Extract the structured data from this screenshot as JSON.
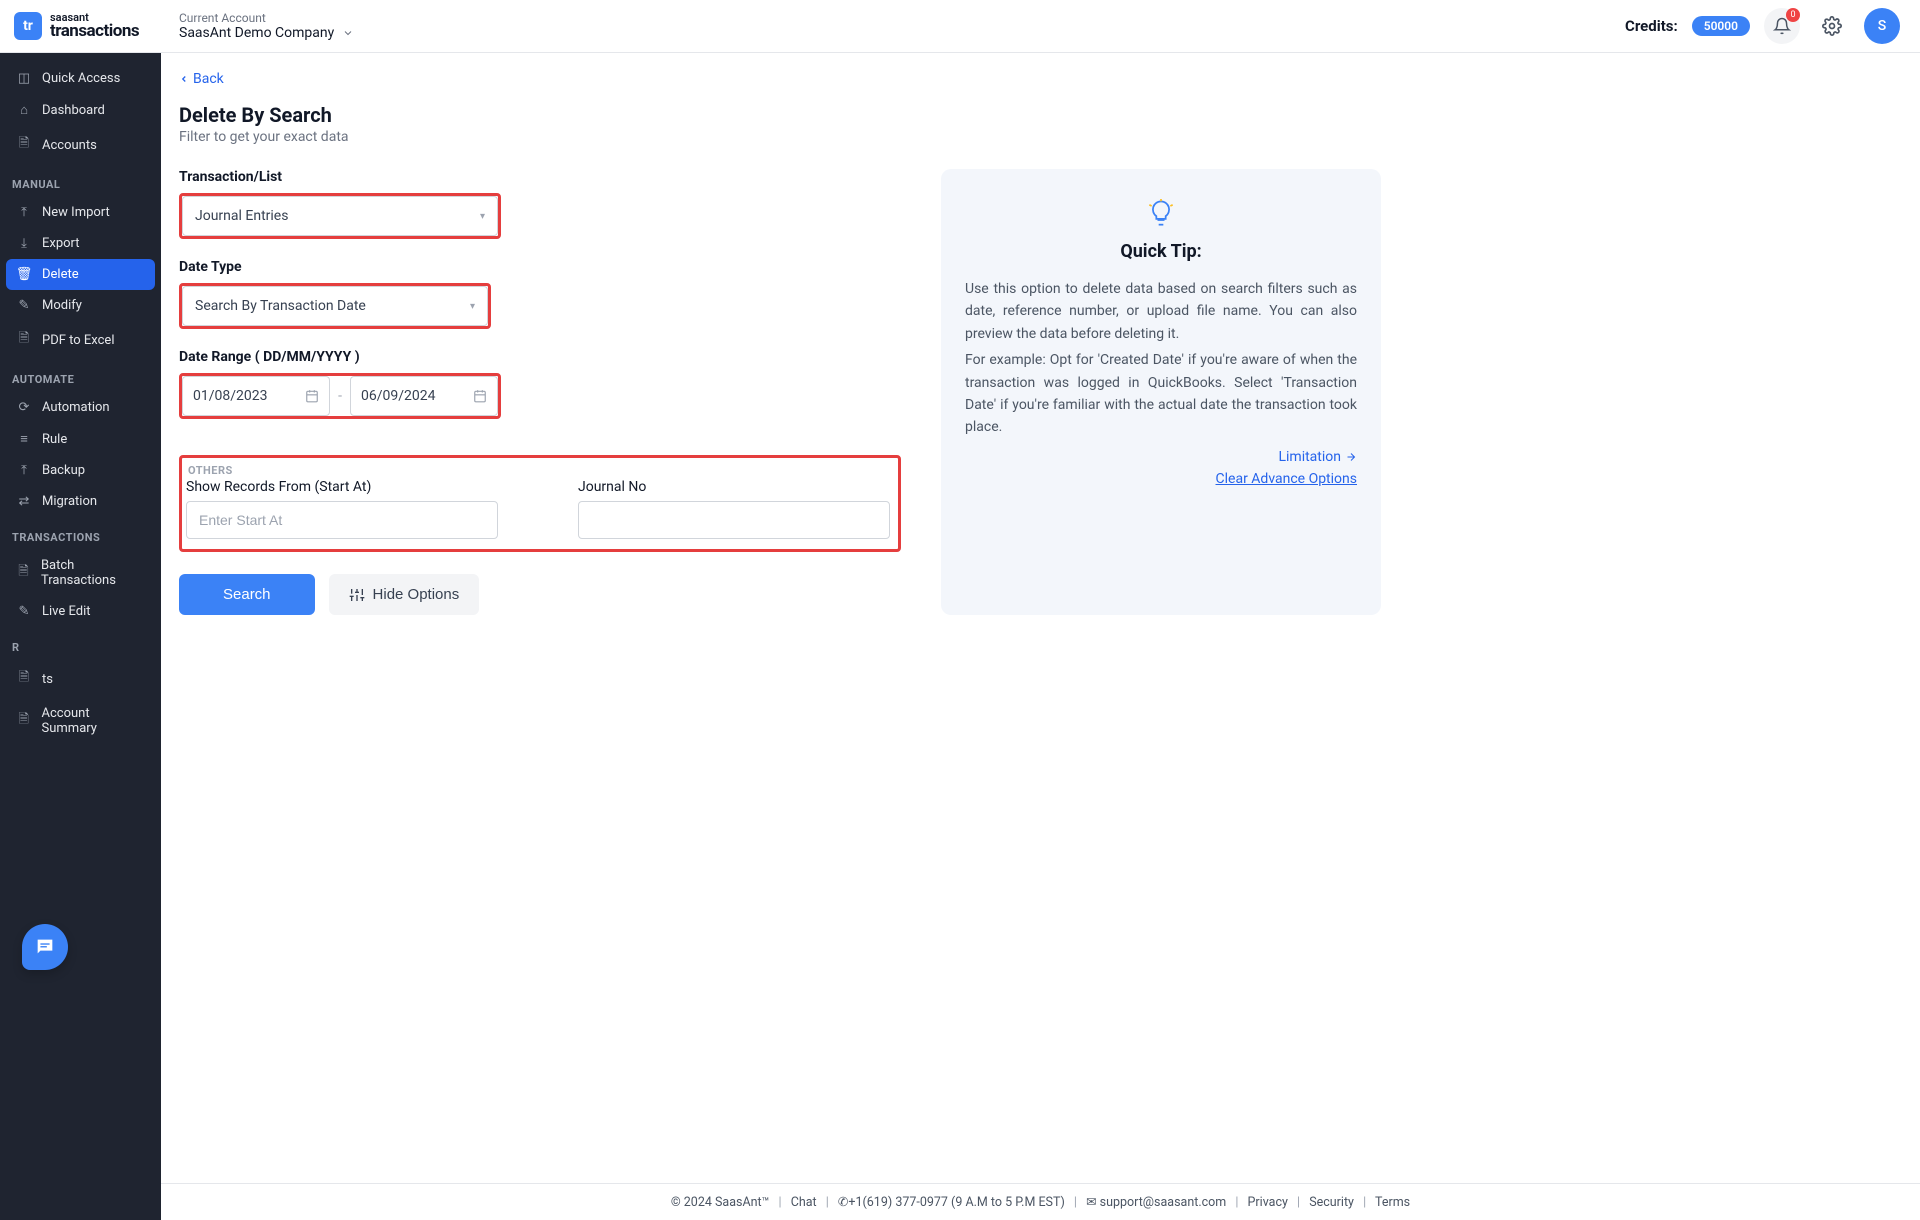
{
  "header": {
    "logo_small": "tr",
    "logo_top": "saasant",
    "logo_bottom": "transactions",
    "account_label": "Current Account",
    "account_name": "SaasAnt Demo Company",
    "credits_label": "Credits:",
    "credits_value": "50000",
    "notif_count": "0",
    "avatar_initial": "S"
  },
  "sidebar": {
    "items_top": [
      {
        "icon": "⊞",
        "label": "Quick Access"
      },
      {
        "icon": "⌂",
        "label": "Dashboard"
      },
      {
        "icon": "🗎",
        "label": "Accounts"
      }
    ],
    "heading_manual": "MANUAL",
    "items_manual": [
      {
        "icon": "⤒",
        "label": "New Import"
      },
      {
        "icon": "⤓",
        "label": "Export"
      },
      {
        "icon": "🗑",
        "label": "Delete",
        "active": true
      },
      {
        "icon": "✎",
        "label": "Modify"
      },
      {
        "icon": "🗎",
        "label": "PDF to Excel"
      }
    ],
    "heading_automate": "AUTOMATE",
    "items_automate": [
      {
        "icon": "⟳",
        "label": "Automation"
      },
      {
        "icon": "≡",
        "label": "Rule"
      },
      {
        "icon": "⤒",
        "label": "Backup"
      },
      {
        "icon": "⇄",
        "label": "Migration"
      }
    ],
    "heading_tx": "TRANSACTIONS",
    "items_tx": [
      {
        "icon": "🗎",
        "label": "Batch Transactions"
      },
      {
        "icon": "✎",
        "label": "Live Edit"
      }
    ],
    "heading_reports": "R",
    "items_reports": [
      {
        "icon": "🗎",
        "label": "ts"
      },
      {
        "icon": "🗎",
        "label": "Account Summary"
      }
    ]
  },
  "main": {
    "back": "Back",
    "title": "Delete By Search",
    "subtitle": "Filter to get your exact data",
    "transaction_label": "Transaction/List",
    "transaction_value": "Journal Entries",
    "datetype_label": "Date Type",
    "datetype_value": "Search By Transaction Date",
    "daterange_label": "Date Range ( DD/MM/YYYY )",
    "date_from": "01/08/2023",
    "date_to": "06/09/2024",
    "others_title": "OTHERS",
    "startat_label": "Show Records From (Start At)",
    "startat_placeholder": "Enter Start At",
    "journalno_label": "Journal No",
    "search_btn": "Search",
    "hide_btn": "Hide Options"
  },
  "tip": {
    "title": "Quick Tip:",
    "p1": "Use this option to delete data based on search filters such as date, reference number, or upload file name. You can also preview the data before deleting it.",
    "p2": "For example: Opt for 'Created Date' if you're aware of when the transaction was logged in QuickBooks. Select 'Transaction Date' if you're familiar with the actual date the transaction took place.",
    "limitation": "Limitation",
    "clear": "Clear Advance Options"
  },
  "footer": {
    "copyright": "© 2024 SaasAnt™",
    "chat": "Chat",
    "phone": "+1(619) 377-0977 (9 A.M to 5 P.M EST)",
    "email": "support@saasant.com",
    "privacy": "Privacy",
    "security": "Security",
    "terms": "Terms"
  }
}
